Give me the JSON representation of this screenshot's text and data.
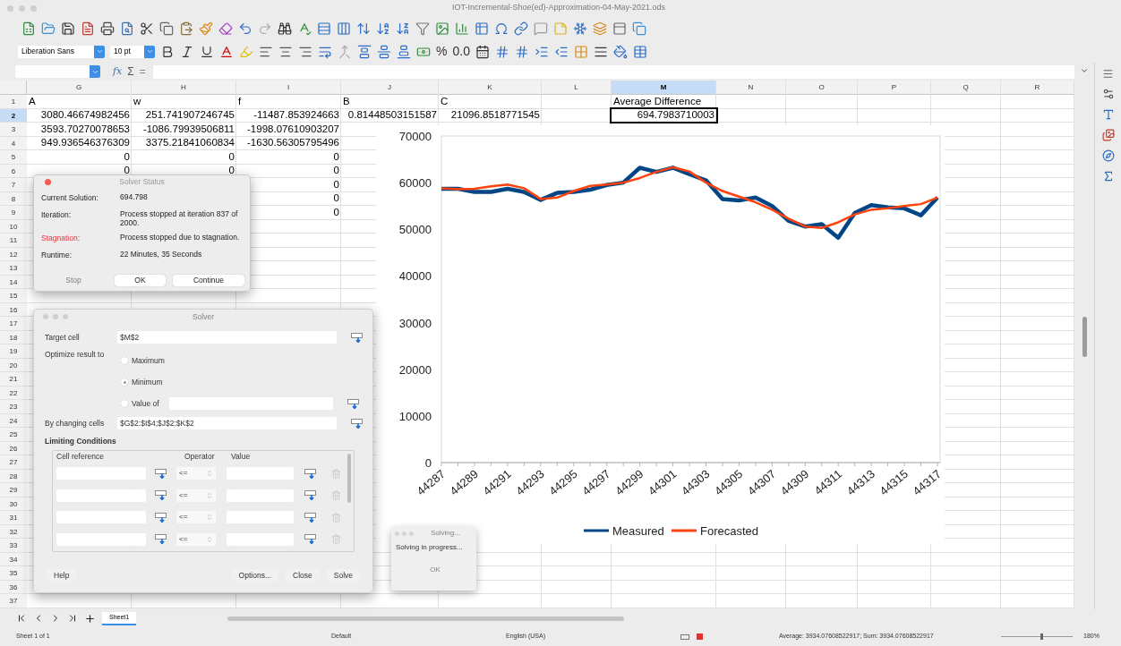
{
  "window": {
    "title": "IOT-Incremental-Shoe(ed)-Approximation-04-May-2021.ods"
  },
  "toolbar": {
    "font_name": "Liberation Sans",
    "font_size": "10 pt",
    "percent": "%",
    "decimal": "0.0"
  },
  "formula_bar": {
    "function_wizard": "fx",
    "sum": "Σ",
    "equals": "="
  },
  "columns": [
    {
      "label": "G",
      "selected": false
    },
    {
      "label": "H",
      "selected": false
    },
    {
      "label": "I",
      "selected": false
    },
    {
      "label": "J",
      "selected": false
    },
    {
      "label": "K",
      "selected": false
    },
    {
      "label": "L",
      "selected": false
    },
    {
      "label": "M",
      "selected": true
    },
    {
      "label": "N",
      "selected": false
    },
    {
      "label": "O",
      "selected": false
    },
    {
      "label": "P",
      "selected": false
    },
    {
      "label": "Q",
      "selected": false
    },
    {
      "label": "R",
      "selected": false
    }
  ],
  "rows": [
    {
      "number": "1",
      "selected": false,
      "cells": [
        {
          "text": "A",
          "kind": "text",
          "selected": false
        },
        {
          "text": "w",
          "kind": "text",
          "selected": false
        },
        {
          "text": "f",
          "kind": "text",
          "selected": false
        },
        {
          "text": "B",
          "kind": "text",
          "selected": false
        },
        {
          "text": "C",
          "kind": "text",
          "selected": false
        },
        null,
        {
          "text": "Average Difference",
          "kind": "text",
          "selected": false
        }
      ]
    },
    {
      "number": "2",
      "selected": true,
      "cells": [
        {
          "text": "3080.46674982456",
          "kind": "number",
          "selected": false
        },
        {
          "text": "251.741907246745",
          "kind": "number",
          "selected": false
        },
        {
          "text": "-11487.853924663",
          "kind": "number",
          "selected": false
        },
        {
          "text": "0.81448503151587",
          "kind": "number",
          "selected": false
        },
        {
          "text": "21096.8518771545",
          "kind": "number",
          "selected": false
        },
        null,
        {
          "text": "694.7983710003",
          "kind": "number",
          "selected": true
        }
      ]
    },
    {
      "number": "3",
      "selected": false,
      "cells": [
        {
          "text": "3593.70270078653",
          "kind": "number",
          "selected": false
        },
        {
          "text": "-1086.79939506811",
          "kind": "number",
          "selected": false
        },
        {
          "text": "-1998.07610903207",
          "kind": "number",
          "selected": false
        }
      ]
    },
    {
      "number": "4",
      "selected": false,
      "cells": [
        {
          "text": "949.936546376309",
          "kind": "number",
          "selected": false
        },
        {
          "text": "3375.21841060834",
          "kind": "number",
          "selected": false
        },
        {
          "text": "-1630.56305795496",
          "kind": "number",
          "selected": false
        }
      ]
    },
    {
      "number": "5",
      "selected": false,
      "cells": [
        {
          "text": "0",
          "kind": "number",
          "selected": false
        },
        {
          "text": "0",
          "kind": "number",
          "selected": false
        },
        {
          "text": "0",
          "kind": "number",
          "selected": false
        }
      ]
    },
    {
      "number": "6",
      "selected": false,
      "cells": [
        {
          "text": "0",
          "kind": "number",
          "selected": false
        },
        {
          "text": "0",
          "kind": "number",
          "selected": false
        },
        {
          "text": "0",
          "kind": "number",
          "selected": false
        }
      ]
    },
    {
      "number": "7",
      "selected": false,
      "cells": [
        null,
        null,
        {
          "text": "0",
          "kind": "number",
          "selected": false
        }
      ]
    },
    {
      "number": "8",
      "selected": false,
      "cells": [
        null,
        null,
        {
          "text": "0",
          "kind": "number",
          "selected": false
        }
      ]
    },
    {
      "number": "9",
      "selected": false,
      "cells": [
        null,
        null,
        {
          "text": "0",
          "kind": "number",
          "selected": false
        }
      ]
    },
    {
      "number": "10",
      "selected": false
    },
    {
      "number": "11",
      "selected": false
    },
    {
      "number": "12",
      "selected": false
    },
    {
      "number": "13",
      "selected": false
    },
    {
      "number": "14",
      "selected": false
    },
    {
      "number": "15",
      "selected": false
    },
    {
      "number": "16",
      "selected": false
    },
    {
      "number": "17",
      "selected": false
    },
    {
      "number": "18",
      "selected": false
    },
    {
      "number": "19",
      "selected": false
    },
    {
      "number": "20",
      "selected": false
    },
    {
      "number": "21",
      "selected": false
    },
    {
      "number": "22",
      "selected": false
    },
    {
      "number": "23",
      "selected": false
    },
    {
      "number": "24",
      "selected": false
    },
    {
      "number": "25",
      "selected": false
    },
    {
      "number": "26",
      "selected": false
    },
    {
      "number": "27",
      "selected": false
    },
    {
      "number": "28",
      "selected": false
    },
    {
      "number": "29",
      "selected": false
    },
    {
      "number": "30",
      "selected": false
    },
    {
      "number": "31",
      "selected": false
    },
    {
      "number": "32",
      "selected": false
    },
    {
      "number": "33",
      "selected": false
    },
    {
      "number": "34",
      "selected": false
    },
    {
      "number": "35",
      "selected": false
    },
    {
      "number": "36",
      "selected": false
    },
    {
      "number": "37",
      "selected": false
    }
  ],
  "chart": {
    "chart_data": {
      "type": "line",
      "x": [
        44287,
        44288,
        44289,
        44290,
        44291,
        44292,
        44293,
        44294,
        44295,
        44296,
        44297,
        44298,
        44299,
        44300,
        44301,
        44302,
        44303,
        44304,
        44305,
        44306,
        44307,
        44308,
        44309,
        44310,
        44311,
        44312,
        44313,
        44314,
        44315,
        44316,
        44317
      ],
      "xticks": [
        44287,
        44289,
        44291,
        44293,
        44295,
        44297,
        44299,
        44301,
        44303,
        44305,
        44307,
        44309,
        44311,
        44313,
        44315,
        44317
      ],
      "xlim": [
        44287,
        44317
      ],
      "legend": "bottom",
      "ylim": [
        0,
        70000
      ],
      "yticks": [
        0,
        10000,
        20000,
        30000,
        40000,
        50000,
        60000,
        70000
      ],
      "series": [
        {
          "name": "Measured",
          "color": "#004586",
          "values": [
            58700,
            58700,
            58000,
            58000,
            58700,
            58000,
            56300,
            57800,
            58000,
            58500,
            59500,
            60000,
            63200,
            62300,
            63200,
            61800,
            60500,
            56500,
            56200,
            56800,
            55000,
            51800,
            50600,
            51100,
            48200,
            53500,
            55200,
            54700,
            54500,
            53000,
            56800
          ]
        },
        {
          "name": "Forecasted",
          "color": "#ff420e",
          "values": [
            58800,
            58600,
            58700,
            59200,
            59600,
            58800,
            56500,
            56800,
            58200,
            59300,
            59600,
            60000,
            61000,
            62300,
            63300,
            62400,
            60000,
            58200,
            57000,
            55800,
            54200,
            52300,
            50600,
            50300,
            51500,
            53200,
            54200,
            54500,
            55000,
            55400,
            56800
          ]
        }
      ]
    }
  },
  "solver_status": {
    "title": "Solver Status",
    "rows": [
      {
        "label": "Current Solution:",
        "value": "694.798",
        "warning": false
      },
      {
        "label": "Iteration:",
        "value": "Process stopped at iteration 837 of 2000.",
        "warning": false
      },
      {
        "label": "Stagnation:",
        "value": "Process stopped due to stagnation.",
        "warning": true
      },
      {
        "label": "Runtime:",
        "value": "22 Minutes, 35 Seconds",
        "warning": false
      }
    ],
    "buttons": [
      {
        "label": "Stop",
        "disabled": true
      },
      {
        "label": "OK",
        "disabled": false
      },
      {
        "label": "Continue",
        "disabled": false
      }
    ]
  },
  "solver": {
    "title": "Solver",
    "target_label": "Target cell",
    "target_value": "$M$2",
    "optimize_label": "Optimize result to",
    "options": [
      {
        "label": "Maximum",
        "selected": false
      },
      {
        "label": "Minimum",
        "selected": true
      },
      {
        "label": "Value of",
        "selected": false
      }
    ],
    "changing_label": "By changing cells",
    "changing_value": "$G$2:$I$4;$J$2:$K$2",
    "limiting_title": "Limiting Conditions",
    "condition_headers": [
      "Cell reference",
      "Operator",
      "Value"
    ],
    "conditions": [
      {
        "operator": "<="
      },
      {
        "operator": "<="
      },
      {
        "operator": "<="
      },
      {
        "operator": "<="
      }
    ],
    "buttons": [
      {
        "label": "Help"
      },
      {
        "label": "Options..."
      },
      {
        "label": "Close"
      },
      {
        "label": "Solve"
      }
    ]
  },
  "solving": {
    "title": "Solving...",
    "message": "Solving in progress...",
    "button": {
      "label": "OK",
      "disabled": true
    }
  },
  "sheet_tabs": [
    {
      "label": "Sheet1",
      "selected": true
    }
  ],
  "status_bar": {
    "sheet": "Sheet 1 of 1",
    "style": "Default",
    "language": "English (USA)",
    "summary": "Average: 3934.07608522917; Sum: 3934.07608522917",
    "zoom": {
      "level": 0.55,
      "reading": "180%"
    }
  }
}
